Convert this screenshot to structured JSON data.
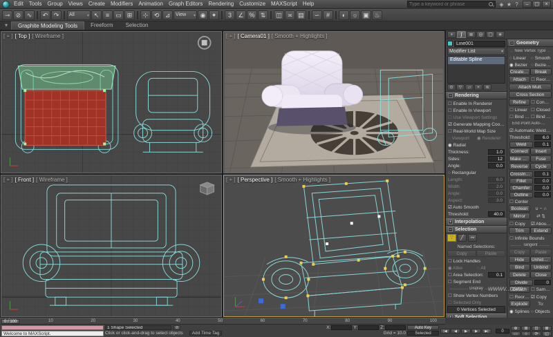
{
  "colors": {
    "ui_background": "#3c3c3c",
    "panel_background": "#454545",
    "viewport_background": "#4a4a4a",
    "wireframe_cyan": "#86d6d6",
    "selected_red": "#a03226",
    "backrest_green": "#7ccd96",
    "handle_yellow": "#f0cf4e",
    "vertex_blue": "#3c6bd8",
    "chair_fabric": "#e9e2f0",
    "active_viewport_border": "#c8a332"
  },
  "titlebar": {
    "menus": [
      "Edit",
      "Tools",
      "Group",
      "Views",
      "Create",
      "Modifiers",
      "Animation",
      "Graph Editors",
      "Rendering",
      "Customize",
      "MAXScript",
      "Help"
    ],
    "search_placeholder": "Type a keyword or phrase",
    "info_icons": [
      {
        "n": "communication-center-icon",
        "g": "◈"
      },
      {
        "n": "favorites-icon",
        "g": "★"
      },
      {
        "n": "infocenter-help-icon",
        "g": "?"
      }
    ],
    "window_buttons": [
      {
        "n": "minimize-button",
        "g": "–"
      },
      {
        "n": "restore-button",
        "g": "▢"
      },
      {
        "n": "close-button",
        "g": "×"
      }
    ]
  },
  "toolbar": {
    "items": [
      {
        "n": "select-and-link-icon",
        "g": "⊸"
      },
      {
        "n": "unlink-selection-icon",
        "g": "⊘"
      },
      {
        "n": "bind-to-space-warp-icon",
        "g": "∿"
      },
      {
        "n": "toolbar-separator",
        "c": "sep"
      },
      {
        "n": "undo-icon",
        "g": "↶"
      },
      {
        "n": "redo-icon",
        "g": "↷"
      },
      {
        "n": "toolbar-separator",
        "c": "sep"
      },
      {
        "n": "selection-filter-dropdown",
        "g": "All",
        "c": "drop"
      },
      {
        "n": "select-object-icon",
        "g": "↖"
      },
      {
        "n": "select-by-name-icon",
        "g": "≡"
      },
      {
        "n": "selection-region-icon",
        "g": "▭"
      },
      {
        "n": "window-crossing-icon",
        "g": "⊞"
      },
      {
        "n": "toolbar-separator",
        "c": "sep"
      },
      {
        "n": "select-and-move-icon",
        "g": "⊹"
      },
      {
        "n": "select-and-rotate-icon",
        "g": "⟲"
      },
      {
        "n": "select-and-scale-icon",
        "g": "⊿"
      },
      {
        "n": "reference-coordinate-dropdown",
        "g": "View",
        "c": "drop"
      },
      {
        "n": "use-center-icon",
        "g": "◉"
      },
      {
        "n": "select-and-manipulate-icon",
        "g": "✦"
      },
      {
        "n": "toolbar-separator",
        "c": "sep"
      },
      {
        "n": "snaps-toggle-icon",
        "g": "3"
      },
      {
        "n": "angle-snap-icon",
        "g": "∠"
      },
      {
        "n": "percent-snap-icon",
        "g": "%"
      },
      {
        "n": "spinner-snap-icon",
        "g": "⇅"
      },
      {
        "n": "toolbar-separator",
        "c": "sep"
      },
      {
        "n": "mirror-icon",
        "g": "◫"
      },
      {
        "n": "align-icon",
        "g": "≍"
      },
      {
        "n": "layer-manager-icon",
        "g": "▤"
      },
      {
        "n": "toolbar-separator",
        "c": "sep"
      },
      {
        "n": "curve-editor-icon",
        "g": "∽"
      },
      {
        "n": "schematic-view-icon",
        "g": "#"
      },
      {
        "n": "toolbar-separator",
        "c": "sep"
      },
      {
        "n": "material-editor-icon",
        "g": "◐"
      },
      {
        "n": "render-setup-icon",
        "g": "☼"
      },
      {
        "n": "rendered-frame-icon",
        "g": "▣"
      },
      {
        "n": "quick-render-icon",
        "g": "♨"
      }
    ]
  },
  "ribbon": {
    "collapse_glyph": "▾",
    "tabs": [
      {
        "label": "Graphite Modeling Tools",
        "cls": "active"
      },
      {
        "label": "Freeform"
      },
      {
        "label": "Selection"
      }
    ]
  },
  "viewports": {
    "top_left": {
      "plus": "[ + ]",
      "view": "[ Top ]",
      "shading": "[ Wireframe ]"
    },
    "top_right": {
      "plus": "[ + ]",
      "view": "[ Camera01 ]",
      "shading": "[ Smooth + Highlights ]"
    },
    "bottom_left": {
      "plus": "[ + ]",
      "view": "[ Front ]",
      "shading": "[ Wireframe ]"
    },
    "bottom_right": {
      "plus": "[ + ]",
      "view": "[ Perspective ]",
      "shading": "[ Smooth + Highlights ]"
    }
  },
  "command_panel": {
    "tabs": [
      {
        "n": "create-tab-icon",
        "g": "+"
      },
      {
        "n": "modify-tab-icon",
        "g": "∫",
        "c": "on"
      },
      {
        "n": "hierarchy-tab-icon",
        "g": "≣"
      },
      {
        "n": "motion-tab-icon",
        "g": "◎"
      },
      {
        "n": "display-tab-icon",
        "g": "▢"
      },
      {
        "n": "utilities-tab-icon",
        "g": "∗"
      }
    ],
    "object_name": "Line001",
    "modifier_list_label": "Modifier List",
    "dropdown_glyph": "▾",
    "stack": [
      "Editable Spline"
    ],
    "stack_tools": [
      {
        "n": "pin-stack-icon",
        "g": "⊙"
      },
      {
        "n": "show-end-result-icon",
        "g": "▽"
      },
      {
        "n": "make-unique-icon",
        "g": "▱"
      },
      {
        "n": "remove-modifier-icon",
        "g": "×"
      },
      {
        "n": "configure-modifier-sets-icon",
        "g": "≋"
      }
    ],
    "rollouts": {
      "rendering": {
        "title": "Rendering",
        "pm": "−",
        "items": [
          {
            "l": "Enable In Renderer",
            "c": "c"
          },
          {
            "l": "Enable In Viewport",
            "c": "c"
          },
          {
            "l": "Use Viewport Settings",
            "c": "c dim"
          },
          {
            "l": "Generate Mapping Coords.",
            "c": "c on"
          },
          {
            "l": "Real-World Map Size",
            "c": "c"
          },
          {
            "l": "Viewport",
            "c": "r h dim"
          },
          {
            "l": "Renderer",
            "c": "r on h dim"
          },
          {
            "l": "Radial",
            "c": "r on"
          },
          {
            "l": "Thickness:",
            "v": "1.0",
            "c": "sr"
          },
          {
            "l": "Sides:",
            "v": "12",
            "c": "sr"
          },
          {
            "l": "Angle:",
            "v": "0.0",
            "c": "sr"
          },
          {
            "l": "Rectangular",
            "c": "r"
          },
          {
            "l": "Length:",
            "v": "6.0",
            "c": "sr dim"
          },
          {
            "l": "Width:",
            "v": "2.0",
            "c": "sr dim"
          },
          {
            "l": "Angle:",
            "v": "0.0",
            "c": "sr dim"
          },
          {
            "l": "Aspect:",
            "v": "3.0",
            "c": "sr dim"
          },
          {
            "l": "Auto Smooth",
            "c": "c on"
          },
          {
            "l": "Threshold:",
            "v": "40.0",
            "c": "sr"
          }
        ]
      },
      "interpolation": {
        "title": "Interpolation",
        "pm": "+"
      },
      "selection": {
        "title": "Selection",
        "pm": "−",
        "icons": [
          {
            "n": "vertex-mode-icon",
            "g": "∵",
            "c": "on"
          },
          {
            "n": "segment-mode-icon",
            "g": "╱"
          },
          {
            "n": "spline-mode-icon",
            "g": "∾"
          }
        ],
        "items": [
          {
            "l": "Named Selections:",
            "c": "lb"
          },
          {
            "l": "Copy",
            "c": "b h dim"
          },
          {
            "l": "Paste",
            "c": "b h dim"
          },
          {
            "l": "Lock Handles",
            "c": "c"
          },
          {
            "l": "Alike",
            "c": "r on h dim"
          },
          {
            "l": "All",
            "c": "r h dim"
          },
          {
            "l": "Area Selection:",
            "v": "0.1",
            "c": "cs"
          },
          {
            "l": "Segment End",
            "c": "c"
          },
          {
            "l": "Display",
            "c": "g"
          },
          {
            "l": "Show Vertex Numbers",
            "c": "c"
          },
          {
            "l": "Selected Only",
            "c": "c dim"
          },
          {
            "l": "0 Vertices Selected",
            "c": "info"
          }
        ]
      },
      "soft_selection": {
        "title": "Soft Selection",
        "pm": "+"
      }
    }
  },
  "geometry_panel": {
    "title": "Geometry",
    "pm": "−",
    "items": [
      {
        "l": "New Vertex Type",
        "c": "g"
      },
      {
        "l": "Linear",
        "c": "r h"
      },
      {
        "l": "Smooth",
        "c": "r h"
      },
      {
        "l": "Bezier",
        "c": "r on h"
      },
      {
        "l": "Bezier Corner",
        "c": "r h"
      },
      {
        "l": "Create Line",
        "c": "b h"
      },
      {
        "l": "Break",
        "c": "b h"
      },
      {
        "l": "Attach",
        "c": "b h"
      },
      {
        "l": "Reorient",
        "c": "c h"
      },
      {
        "l": "Attach Mult.",
        "c": "b w"
      },
      {
        "l": "Cross Section",
        "c": "b w"
      },
      {
        "l": "Refine",
        "c": "b h"
      },
      {
        "l": "Connect",
        "c": "c h"
      },
      {
        "l": "Linear",
        "c": "c h"
      },
      {
        "l": "Closed",
        "c": "c h"
      },
      {
        "l": "Bind first",
        "c": "c h"
      },
      {
        "l": "Bind last",
        "c": "c h"
      },
      {
        "l": "End Point Auto-Welding",
        "c": "g"
      },
      {
        "l": "Automatic Welding",
        "c": "c on"
      },
      {
        "l": "Threshold:",
        "v": "6.0",
        "c": "sr"
      },
      {
        "l": "Weld",
        "v": "0.1",
        "c": "bs"
      },
      {
        "l": "Connect",
        "c": "b h"
      },
      {
        "l": "Insert",
        "c": "b h"
      },
      {
        "l": "Make First",
        "c": "b h"
      },
      {
        "l": "Fuse",
        "c": "b h"
      },
      {
        "l": "Reverse",
        "c": "b h"
      },
      {
        "l": "Cycle",
        "c": "b h"
      },
      {
        "l": "CrossInsert",
        "v": "0.1",
        "c": "bs"
      },
      {
        "l": "Fillet",
        "v": "0.0",
        "c": "bs"
      },
      {
        "l": "Chamfer",
        "v": "0.0",
        "c": "bs"
      },
      {
        "l": "Outline",
        "v": "0.0",
        "c": "bs"
      },
      {
        "l": "Center",
        "c": "c"
      },
      {
        "l": "Boolean",
        "c": "b h"
      },
      {
        "l": "∪ − ∩",
        "c": "lb h"
      },
      {
        "l": "Mirror",
        "c": "b h"
      },
      {
        "l": "⇄ ⇅",
        "c": "lb h"
      },
      {
        "l": "Copy",
        "c": "c h"
      },
      {
        "l": "About Pivot",
        "c": "c on h"
      },
      {
        "l": "Trim",
        "c": "b h"
      },
      {
        "l": "Extend",
        "c": "b h"
      },
      {
        "l": "Infinite Bounds",
        "c": "c"
      },
      {
        "l": "Tangent",
        "c": "g"
      },
      {
        "l": "Copy",
        "c": "b h dim"
      },
      {
        "l": "Paste",
        "c": "b h dim"
      },
      {
        "l": "Hide",
        "c": "b h"
      },
      {
        "l": "Unhide All",
        "c": "b h"
      },
      {
        "l": "Bind",
        "c": "b h"
      },
      {
        "l": "Unbind",
        "c": "b h"
      },
      {
        "l": "Delete",
        "c": "b h"
      },
      {
        "l": "Close",
        "c": "b h"
      },
      {
        "l": "Divide",
        "v": "0",
        "c": "bs"
      },
      {
        "l": "Detach",
        "c": "b h"
      },
      {
        "l": "Same Shp",
        "c": "c h"
      },
      {
        "l": "Reorient",
        "c": "c h"
      },
      {
        "l": "Copy",
        "c": "c on h"
      },
      {
        "l": "Explode",
        "c": "b h"
      },
      {
        "l": "To:",
        "c": "lb h"
      },
      {
        "l": "Splines",
        "c": "r on h"
      },
      {
        "l": "Objects",
        "c": "r h"
      }
    ]
  },
  "timeline": {
    "slider_label": "0 / 100",
    "ticks": [
      "0",
      "10",
      "20",
      "30",
      "40",
      "50",
      "60",
      "70",
      "80",
      "90",
      "100"
    ]
  },
  "statusbar": {
    "maxscript_line": "Welcome to MAXScript.",
    "status_line": "1 Shape Selected",
    "lock_glyph": "⊘",
    "prompt_line": "Click or click-and-drag to select objects",
    "time_tag": "Add Time Tag",
    "grid_label": "Grid = 10.0",
    "coords": [
      {
        "label": "X:",
        "value": ""
      },
      {
        "label": "Y:",
        "value": ""
      },
      {
        "label": "Z:",
        "value": ""
      }
    ],
    "auto_key": "Auto Key",
    "selected_label": "Selected",
    "playback": [
      {
        "n": "go-to-start-button",
        "g": "|◀"
      },
      {
        "n": "previous-frame-button",
        "g": "◀"
      },
      {
        "n": "play-animation-button",
        "g": "▶"
      },
      {
        "n": "next-frame-button",
        "g": "▶"
      },
      {
        "n": "go-to-end-button",
        "g": "▶|"
      }
    ],
    "frame_field": "0",
    "nav_buttons": [
      {
        "n": "zoom-icon",
        "g": "⊕"
      },
      {
        "n": "zoom-all-icon",
        "g": "⊞"
      },
      {
        "n": "zoom-extents-icon",
        "g": "⊡"
      },
      {
        "n": "zoom-extents-all-icon",
        "g": "⊠"
      },
      {
        "n": "zoom-region-icon",
        "g": "▭"
      },
      {
        "n": "pan-view-icon",
        "g": "⊹"
      },
      {
        "n": "orbit-icon",
        "g": "⟳"
      },
      {
        "n": "maximize-viewport-toggle-icon",
        "g": "◱"
      }
    ]
  },
  "watermark": "wwwv..com"
}
